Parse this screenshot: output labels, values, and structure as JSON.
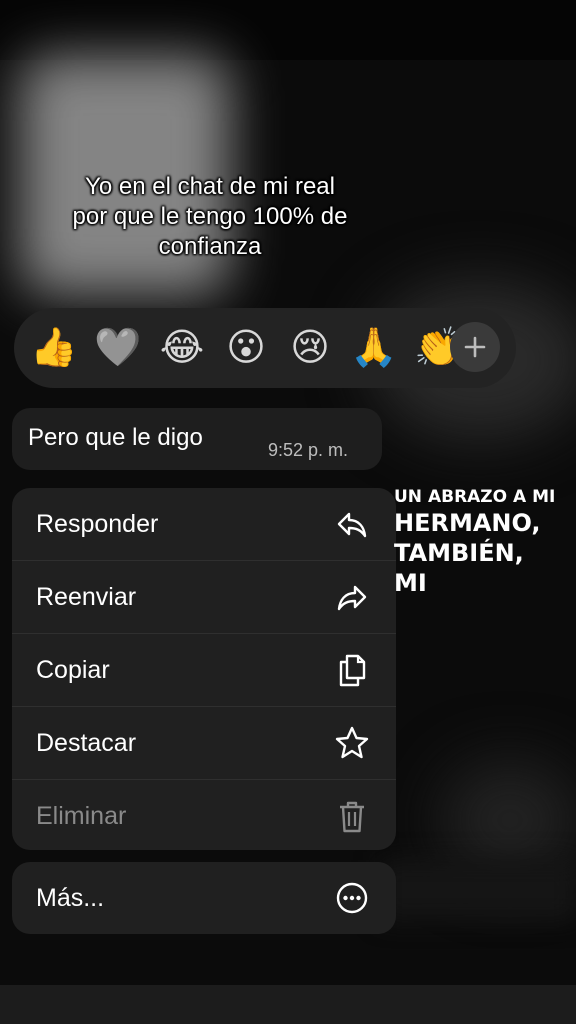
{
  "caption": {
    "line1": "Yo en el chat de mi real",
    "line2": "por que le tengo 100% de",
    "line3": "confianza"
  },
  "reactions": {
    "emojis": [
      "👍",
      "🩶",
      "😂",
      "😮",
      "😢",
      "🙏",
      "👏"
    ],
    "add_label": "+"
  },
  "message": {
    "text": "Pero que le digo",
    "time": "9:52 p. m."
  },
  "menu": {
    "items": [
      {
        "label": "Responder",
        "icon": "reply-icon"
      },
      {
        "label": "Reenviar",
        "icon": "forward-icon"
      },
      {
        "label": "Copiar",
        "icon": "copy-icon"
      },
      {
        "label": "Destacar",
        "icon": "star-icon"
      },
      {
        "label": "Eliminar",
        "icon": "trash-icon"
      }
    ],
    "more_label": "Más...",
    "more_icon": "more-icon"
  },
  "overlay_text": {
    "line1": "UN ABRAZO A MI",
    "line2": "HERMANO,",
    "line3": "TAMBIÉN,",
    "line4": "MI"
  }
}
